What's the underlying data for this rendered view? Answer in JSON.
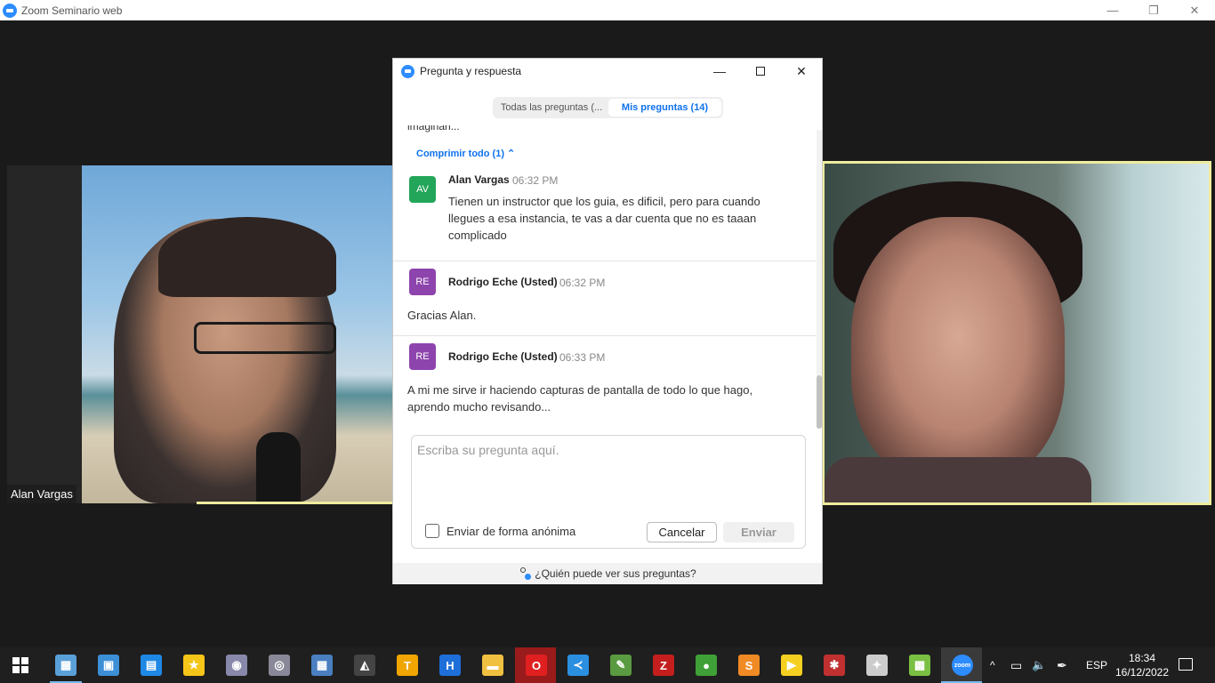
{
  "window": {
    "title": "Zoom Seminario web",
    "minimize_glyph": "—",
    "restore_glyph": "❐",
    "close_glyph": "✕"
  },
  "participants": {
    "left_name": "Alan Vargas"
  },
  "qa": {
    "title": "Pregunta y respuesta",
    "minimize_glyph": "—",
    "close_glyph": "✕",
    "tabs": [
      {
        "label": "Todas las preguntas (..."
      },
      {
        "label": "Mis preguntas (14)"
      }
    ],
    "cut_text": "imaginan...",
    "collapse_label": "Comprimir todo (1) ⌃",
    "messages": [
      {
        "avatar": "AV",
        "avatar_color": "#23a55a",
        "name": "Alan Vargas",
        "time": "06:32 PM",
        "text_lines": [
          "Tienen un instructor que los guia, es dificil, pero para cuando",
          "llegues a esa instancia, te vas a dar cuenta que no es taaan",
          "complicado"
        ]
      },
      {
        "avatar": "RE",
        "avatar_color": "#8e44ad",
        "name": "Rodrigo Eche (Usted)",
        "time": "06:32 PM",
        "text_lines": [
          "Gracias Alan."
        ]
      },
      {
        "avatar": "RE",
        "avatar_color": "#8e44ad",
        "name": "Rodrigo Eche (Usted)",
        "time": "06:33 PM",
        "text_lines": [
          "A mi me sirve ir haciendo capturas de pantalla de todo lo que hago,",
          "aprendo mucho revisando..."
        ]
      }
    ],
    "compose": {
      "placeholder": "Escriba su pregunta aquí.",
      "anonymous_label": "Enviar de forma anónima",
      "anonymous_checked": false,
      "cancel_label": "Cancelar",
      "send_label": "Enviar"
    },
    "footer_label": "¿Quién puede ver sus preguntas?"
  },
  "taskbar": {
    "icons": [
      {
        "name": "task-manager-icon",
        "glyph": "▦",
        "color": "#5aa0d8"
      },
      {
        "name": "control-panel-icon",
        "glyph": "▣",
        "color": "#3d8fd6"
      },
      {
        "name": "news-app-icon",
        "glyph": "▤",
        "color": "#1e88e5"
      },
      {
        "name": "favorites-star-icon",
        "glyph": "★",
        "color": "#f5c518"
      },
      {
        "name": "paint-palette-icon",
        "glyph": "◉",
        "color": "#88a"
      },
      {
        "name": "camera-icon",
        "glyph": "◎",
        "color": "#889"
      },
      {
        "name": "calculator-icon",
        "glyph": "▦",
        "color": "#4a7fc0"
      },
      {
        "name": "inkscape-icon",
        "glyph": "◭",
        "color": "#444"
      },
      {
        "name": "teamviewer-icon",
        "glyph": "T",
        "color": "#f0a500"
      },
      {
        "name": "h-app-icon",
        "glyph": "H",
        "color": "#1e6fd9"
      },
      {
        "name": "file-explorer-icon",
        "glyph": "▬",
        "color": "#f0c040"
      },
      {
        "name": "opera-icon",
        "glyph": "O",
        "color": "#e02020"
      },
      {
        "name": "vscode-icon",
        "glyph": "≺",
        "color": "#2b8fe0"
      },
      {
        "name": "notepad-icon",
        "glyph": "✎",
        "color": "#5a9a40"
      },
      {
        "name": "filezilla-icon",
        "glyph": "Z",
        "color": "#c41e1e"
      },
      {
        "name": "mongodb-icon",
        "glyph": "●",
        "color": "#3fa037"
      },
      {
        "name": "sublime-icon",
        "glyph": "S",
        "color": "#f08a24"
      },
      {
        "name": "folder-arrow-icon",
        "glyph": "▶",
        "color": "#f5d020"
      },
      {
        "name": "app-64-icon",
        "glyph": "✱",
        "color": "#c03030"
      },
      {
        "name": "satellite-icon",
        "glyph": "✦",
        "color": "#ccc"
      },
      {
        "name": "rainbow-app-icon",
        "glyph": "▩",
        "color": "#7ac043"
      },
      {
        "name": "zoom-icon",
        "glyph": "zoom",
        "color": "#2d8cff"
      }
    ],
    "tray": {
      "chevron": "^",
      "battery": "▭",
      "volume": "🔈",
      "pen": "✒",
      "language": "ESP",
      "time": "18:34",
      "date": "16/12/2022"
    }
  }
}
